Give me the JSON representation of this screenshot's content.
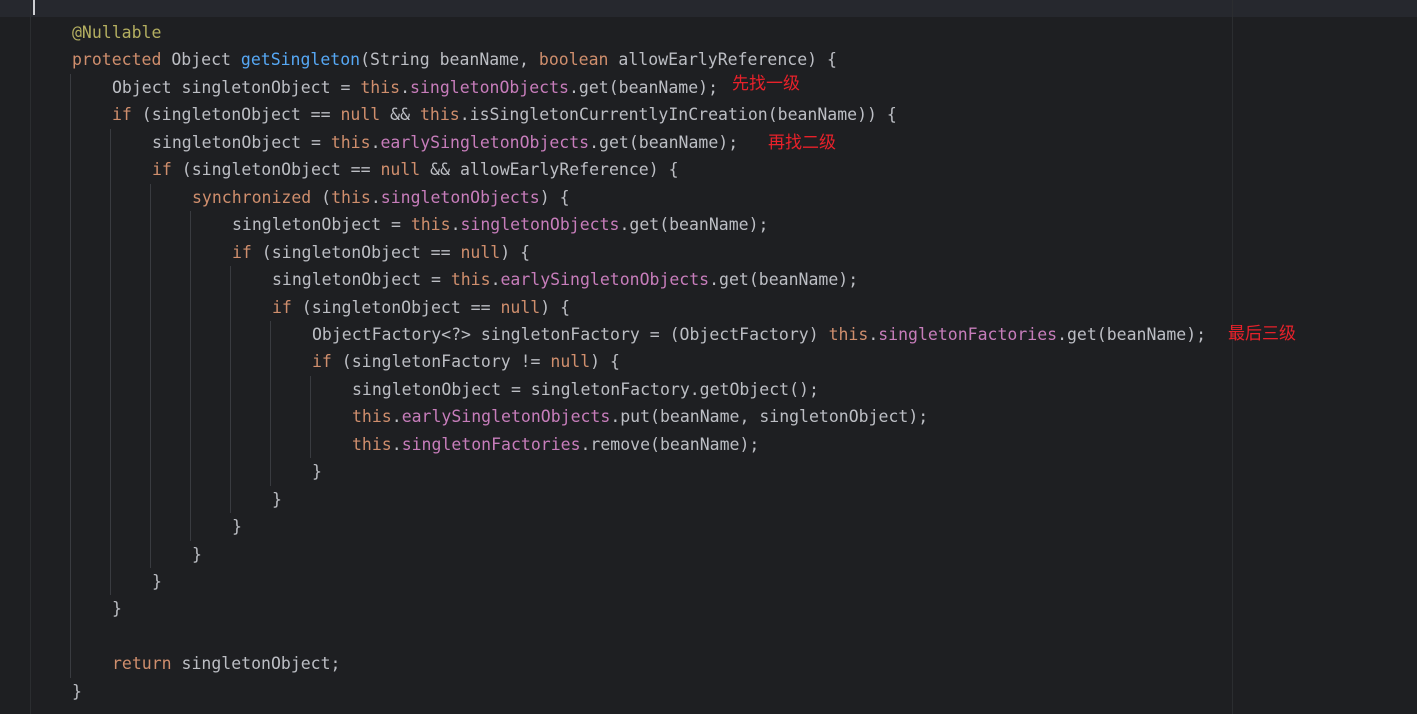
{
  "colors": {
    "background": "#1e1f22",
    "keyword": "#cf8e6d",
    "field": "#c77dbb",
    "method_declaration": "#56a8f5",
    "annotation": "#b3ae60",
    "default_text": "#bcbec4",
    "note_text": "#e8212a"
  },
  "code": {
    "language": "java",
    "lines": [
      {
        "indent": 0,
        "tokens": [
          {
            "t": "@Nullable",
            "k": "anno"
          }
        ]
      },
      {
        "indent": 0,
        "tokens": [
          {
            "t": "protected",
            "k": "kw"
          },
          {
            "t": " Object ",
            "k": "plain"
          },
          {
            "t": "getSingleton",
            "k": "fn"
          },
          {
            "t": "(String beanName, ",
            "k": "plain"
          },
          {
            "t": "boolean",
            "k": "kw"
          },
          {
            "t": " allowEarlyReference) {",
            "k": "plain"
          }
        ]
      },
      {
        "indent": 1,
        "tokens": [
          {
            "t": "Object singletonObject = ",
            "k": "plain"
          },
          {
            "t": "this",
            "k": "kw"
          },
          {
            "t": ".",
            "k": "plain"
          },
          {
            "t": "singletonObjects",
            "k": "field"
          },
          {
            "t": ".get(beanName);",
            "k": "plain"
          }
        ]
      },
      {
        "indent": 1,
        "tokens": [
          {
            "t": "if",
            "k": "kw"
          },
          {
            "t": " (singletonObject == ",
            "k": "plain"
          },
          {
            "t": "null",
            "k": "kw"
          },
          {
            "t": " && ",
            "k": "plain"
          },
          {
            "t": "this",
            "k": "kw"
          },
          {
            "t": ".isSingletonCurrentlyInCreation(beanName)) {",
            "k": "plain"
          }
        ]
      },
      {
        "indent": 2,
        "tokens": [
          {
            "t": "singletonObject = ",
            "k": "plain"
          },
          {
            "t": "this",
            "k": "kw"
          },
          {
            "t": ".",
            "k": "plain"
          },
          {
            "t": "earlySingletonObjects",
            "k": "field"
          },
          {
            "t": ".get(beanName);",
            "k": "plain"
          }
        ]
      },
      {
        "indent": 2,
        "tokens": [
          {
            "t": "if",
            "k": "kw"
          },
          {
            "t": " (singletonObject == ",
            "k": "plain"
          },
          {
            "t": "null",
            "k": "kw"
          },
          {
            "t": " && allowEarlyReference) {",
            "k": "plain"
          }
        ]
      },
      {
        "indent": 3,
        "tokens": [
          {
            "t": "synchronized",
            "k": "kw"
          },
          {
            "t": " (",
            "k": "plain"
          },
          {
            "t": "this",
            "k": "kw"
          },
          {
            "t": ".",
            "k": "plain"
          },
          {
            "t": "singletonObjects",
            "k": "field"
          },
          {
            "t": ") {",
            "k": "plain"
          }
        ]
      },
      {
        "indent": 4,
        "tokens": [
          {
            "t": "singletonObject = ",
            "k": "plain"
          },
          {
            "t": "this",
            "k": "kw"
          },
          {
            "t": ".",
            "k": "plain"
          },
          {
            "t": "singletonObjects",
            "k": "field"
          },
          {
            "t": ".get(beanName);",
            "k": "plain"
          }
        ]
      },
      {
        "indent": 4,
        "tokens": [
          {
            "t": "if",
            "k": "kw"
          },
          {
            "t": " (singletonObject == ",
            "k": "plain"
          },
          {
            "t": "null",
            "k": "kw"
          },
          {
            "t": ") {",
            "k": "plain"
          }
        ]
      },
      {
        "indent": 5,
        "tokens": [
          {
            "t": "singletonObject = ",
            "k": "plain"
          },
          {
            "t": "this",
            "k": "kw"
          },
          {
            "t": ".",
            "k": "plain"
          },
          {
            "t": "earlySingletonObjects",
            "k": "field"
          },
          {
            "t": ".get(beanName);",
            "k": "plain"
          }
        ]
      },
      {
        "indent": 5,
        "tokens": [
          {
            "t": "if",
            "k": "kw"
          },
          {
            "t": " (singletonObject == ",
            "k": "plain"
          },
          {
            "t": "null",
            "k": "kw"
          },
          {
            "t": ") {",
            "k": "plain"
          }
        ]
      },
      {
        "indent": 6,
        "tokens": [
          {
            "t": "ObjectFactory<?> singletonFactory = (ObjectFactory) ",
            "k": "plain"
          },
          {
            "t": "this",
            "k": "kw"
          },
          {
            "t": ".",
            "k": "plain"
          },
          {
            "t": "singletonFactories",
            "k": "field"
          },
          {
            "t": ".get(beanName);",
            "k": "plain"
          }
        ]
      },
      {
        "indent": 6,
        "tokens": [
          {
            "t": "if",
            "k": "kw"
          },
          {
            "t": " (singletonFactory != ",
            "k": "plain"
          },
          {
            "t": "null",
            "k": "kw"
          },
          {
            "t": ") {",
            "k": "plain"
          }
        ]
      },
      {
        "indent": 7,
        "tokens": [
          {
            "t": "singletonObject = singletonFactory.getObject();",
            "k": "plain"
          }
        ]
      },
      {
        "indent": 7,
        "tokens": [
          {
            "t": "this",
            "k": "kw"
          },
          {
            "t": ".",
            "k": "plain"
          },
          {
            "t": "earlySingletonObjects",
            "k": "field"
          },
          {
            "t": ".put(beanName, singletonObject);",
            "k": "plain"
          }
        ]
      },
      {
        "indent": 7,
        "tokens": [
          {
            "t": "this",
            "k": "kw"
          },
          {
            "t": ".",
            "k": "plain"
          },
          {
            "t": "singletonFactories",
            "k": "field"
          },
          {
            "t": ".remove(beanName);",
            "k": "plain"
          }
        ]
      },
      {
        "indent": 6,
        "tokens": [
          {
            "t": "}",
            "k": "plain"
          }
        ]
      },
      {
        "indent": 5,
        "tokens": [
          {
            "t": "}",
            "k": "plain"
          }
        ]
      },
      {
        "indent": 4,
        "tokens": [
          {
            "t": "}",
            "k": "plain"
          }
        ]
      },
      {
        "indent": 3,
        "tokens": [
          {
            "t": "}",
            "k": "plain"
          }
        ]
      },
      {
        "indent": 2,
        "tokens": [
          {
            "t": "}",
            "k": "plain"
          }
        ]
      },
      {
        "indent": 1,
        "tokens": [
          {
            "t": "}",
            "k": "plain"
          }
        ]
      },
      {
        "indent": 0,
        "tokens": []
      },
      {
        "indent": 1,
        "tokens": [
          {
            "t": "return",
            "k": "kw"
          },
          {
            "t": " singletonObject;",
            "k": "plain"
          }
        ]
      },
      {
        "indent": 0,
        "tokens": [
          {
            "t": "}",
            "k": "plain"
          }
        ]
      }
    ]
  },
  "annotations": {
    "first_level": "先找一级",
    "second_level": "再找二级",
    "third_level": "最后三级"
  }
}
